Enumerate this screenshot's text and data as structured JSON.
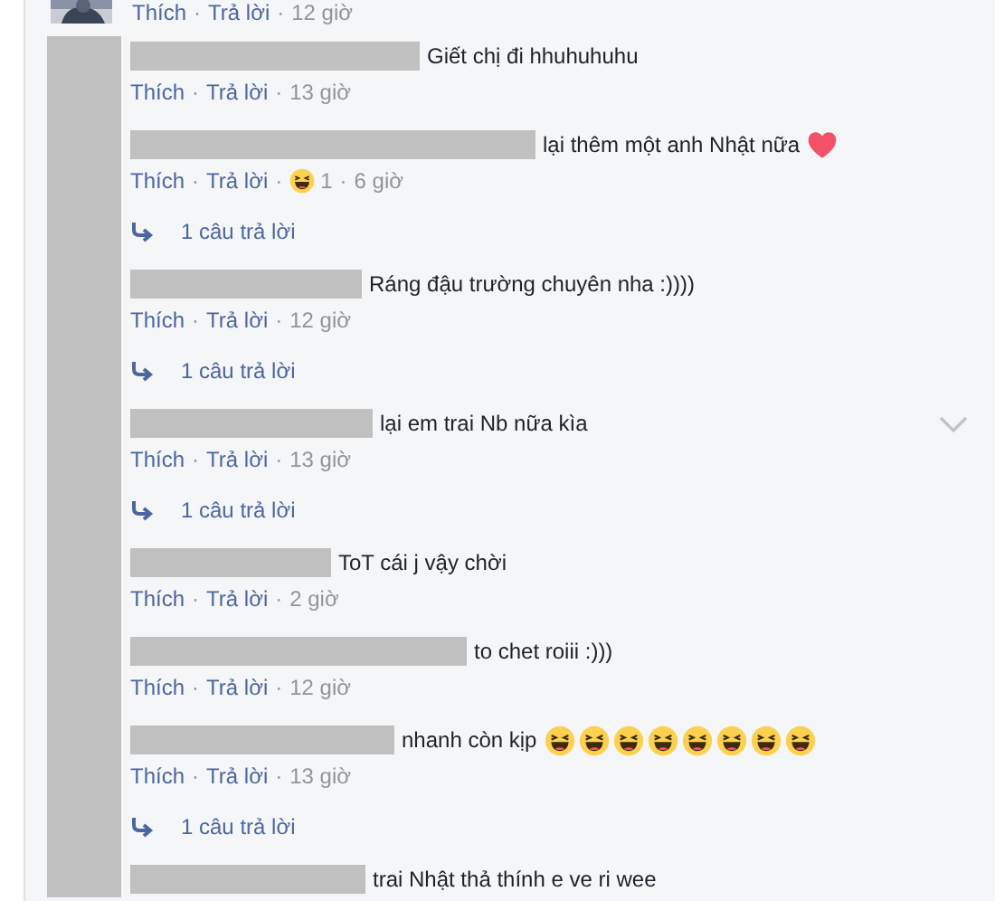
{
  "top_comment": {
    "actions": [
      {
        "kind": "link",
        "text": "Thích"
      },
      {
        "kind": "separator",
        "text": "·"
      },
      {
        "kind": "link",
        "text": "Trả lời"
      },
      {
        "kind": "separator",
        "text": "·"
      },
      {
        "kind": "time",
        "text": "12 giờ"
      }
    ]
  },
  "comments": [
    {
      "text": "Giết chị đi hhuhuhuhu",
      "actions": [
        {
          "kind": "link",
          "text": "Thích"
        },
        {
          "kind": "separator",
          "text": "·"
        },
        {
          "kind": "link",
          "text": "Trả lời"
        },
        {
          "kind": "separator",
          "text": "·"
        },
        {
          "kind": "time",
          "text": "13 giờ"
        }
      ],
      "options_shown": false
    },
    {
      "text": "lại thêm một anh Nhật nữa",
      "emojis": [
        {
          "kind": "heart"
        }
      ],
      "actions": [
        {
          "kind": "link",
          "text": "Thích"
        },
        {
          "kind": "separator",
          "text": "·"
        },
        {
          "kind": "link",
          "text": "Trả lời"
        },
        {
          "kind": "separator",
          "text": "·"
        },
        {
          "kind": "reaction",
          "text": "1"
        },
        {
          "kind": "separator",
          "text": "·"
        },
        {
          "kind": "time",
          "text": "6 giờ"
        }
      ],
      "replies": "1 câu trả lời",
      "options_shown": false
    },
    {
      "text": "Ráng đậu trường chuyên nha :))))",
      "actions": [
        {
          "kind": "link",
          "text": "Thích"
        },
        {
          "kind": "separator",
          "text": "·"
        },
        {
          "kind": "link",
          "text": "Trả lời"
        },
        {
          "kind": "separator",
          "text": "·"
        },
        {
          "kind": "time",
          "text": "12 giờ"
        }
      ],
      "replies": "1 câu trả lời",
      "options_shown": false
    },
    {
      "text": "lại em trai Nb nữa kìa",
      "actions": [
        {
          "kind": "link",
          "text": "Thích"
        },
        {
          "kind": "separator",
          "text": "·"
        },
        {
          "kind": "link",
          "text": "Trả lời"
        },
        {
          "kind": "separator",
          "text": "·"
        },
        {
          "kind": "time",
          "text": "13 giờ"
        }
      ],
      "replies": "1 câu trả lời",
      "options_shown": true
    },
    {
      "text": "ToT cái j vậy chời",
      "actions": [
        {
          "kind": "link",
          "text": "Thích"
        },
        {
          "kind": "separator",
          "text": "·"
        },
        {
          "kind": "link",
          "text": "Trả lời"
        },
        {
          "kind": "separator",
          "text": "·"
        },
        {
          "kind": "time",
          "text": "2 giờ"
        }
      ],
      "options_shown": false
    },
    {
      "text": "to chet roiii :)))",
      "actions": [
        {
          "kind": "link",
          "text": "Thích"
        },
        {
          "kind": "separator",
          "text": "·"
        },
        {
          "kind": "link",
          "text": "Trả lời"
        },
        {
          "kind": "separator",
          "text": "·"
        },
        {
          "kind": "time",
          "text": "12 giờ"
        }
      ],
      "options_shown": false
    },
    {
      "text": "nhanh còn kịp",
      "emojis": [
        {
          "kind": "laugh"
        },
        {
          "kind": "laugh"
        },
        {
          "kind": "laugh"
        },
        {
          "kind": "laugh"
        },
        {
          "kind": "laugh"
        },
        {
          "kind": "laugh"
        },
        {
          "kind": "laugh"
        },
        {
          "kind": "laugh"
        }
      ],
      "actions": [
        {
          "kind": "link",
          "text": "Thích"
        },
        {
          "kind": "separator",
          "text": "·"
        },
        {
          "kind": "link",
          "text": "Trả lời"
        },
        {
          "kind": "separator",
          "text": "·"
        },
        {
          "kind": "time",
          "text": "13 giờ"
        }
      ],
      "replies": "1 câu trả lời",
      "options_shown": false
    },
    {
      "text": "trai Nhật thả thính e ve ri wee",
      "options_shown": false
    }
  ]
}
